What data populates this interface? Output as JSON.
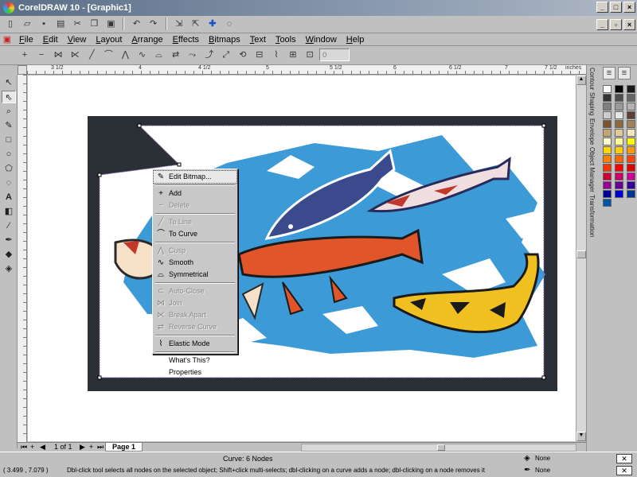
{
  "window": {
    "title": "CorelDRAW 10 - [Graphic1]"
  },
  "menu": [
    "File",
    "Edit",
    "View",
    "Layout",
    "Arrange",
    "Effects",
    "Bitmaps",
    "Text",
    "Tools",
    "Window",
    "Help"
  ],
  "property_bar": {
    "node_value": "0"
  },
  "ruler": {
    "units": "inches",
    "labels": [
      "3 1/2",
      "4",
      "4 1/2",
      "5",
      "5 1/2",
      "6",
      "6 1/2",
      "7",
      "7 1/2"
    ]
  },
  "context_menu": {
    "items": [
      {
        "label": "Edit Bitmap...",
        "enabled": true,
        "icon": "edit-bitmap-icon",
        "highlighted": true
      },
      {
        "sep": true
      },
      {
        "label": "Add",
        "enabled": true,
        "icon": "add-node-icon"
      },
      {
        "label": "Delete",
        "enabled": false,
        "icon": "delete-node-icon"
      },
      {
        "sep": true
      },
      {
        "label": "To Line",
        "enabled": false,
        "icon": "to-line-icon"
      },
      {
        "label": "To Curve",
        "enabled": true,
        "icon": "to-curve-icon"
      },
      {
        "sep": true
      },
      {
        "label": "Cusp",
        "enabled": false,
        "icon": "cusp-icon"
      },
      {
        "label": "Smooth",
        "enabled": true,
        "icon": "smooth-icon"
      },
      {
        "label": "Symmetrical",
        "enabled": true,
        "icon": "symmetrical-icon"
      },
      {
        "sep": true
      },
      {
        "label": "Auto-Close",
        "enabled": false,
        "icon": "auto-close-icon"
      },
      {
        "label": "Join",
        "enabled": false,
        "icon": "join-icon"
      },
      {
        "label": "Break Apart",
        "enabled": false,
        "icon": "break-apart-icon"
      },
      {
        "label": "Reverse Curve",
        "enabled": false,
        "icon": "reverse-curve-icon"
      },
      {
        "sep": true
      },
      {
        "label": "Elastic Mode",
        "enabled": true,
        "icon": "elastic-mode-icon"
      },
      {
        "sep": true
      },
      {
        "label": "What's This?",
        "enabled": true,
        "icon": ""
      },
      {
        "label": "Properties",
        "enabled": true,
        "icon": ""
      }
    ]
  },
  "dockers": [
    "Contour",
    "Shaping",
    "Envelope",
    "Object Manager",
    "Transformation"
  ],
  "palette_colors": [
    "#ffffff",
    "#000000",
    "#1a1a1a",
    "#333333",
    "#4d4d4d",
    "#666666",
    "#808080",
    "#999999",
    "#b3b3b3",
    "#cccccc",
    "#e6e6e6",
    "#5c4033",
    "#7a5230",
    "#8b6b3d",
    "#a0825a",
    "#c4a574",
    "#e0c898",
    "#f5e6b8",
    "#ffffcc",
    "#ffff99",
    "#ffff00",
    "#ffd700",
    "#ffcc00",
    "#ff9900",
    "#ff8000",
    "#ff6600",
    "#ff4500",
    "#ff3300",
    "#ff0000",
    "#e00000",
    "#cc0033",
    "#cc0066",
    "#cc0099",
    "#990099",
    "#660099",
    "#330099",
    "#000099",
    "#0000cc",
    "#003399",
    "#0055aa"
  ],
  "page_tabs": {
    "counter": "1 of 1",
    "page_label": "Page 1"
  },
  "status": {
    "object_info": "Curve: 6 Nodes",
    "coordinates": "( 3.499 , 7.079 )",
    "hint": "Dbl-click tool selects all nodes on the selected object; Shift+click multi-selects; dbl-clicking on a curve adds a node; dbl-clicking on a node removes it",
    "fill": "None",
    "outline": "None"
  }
}
